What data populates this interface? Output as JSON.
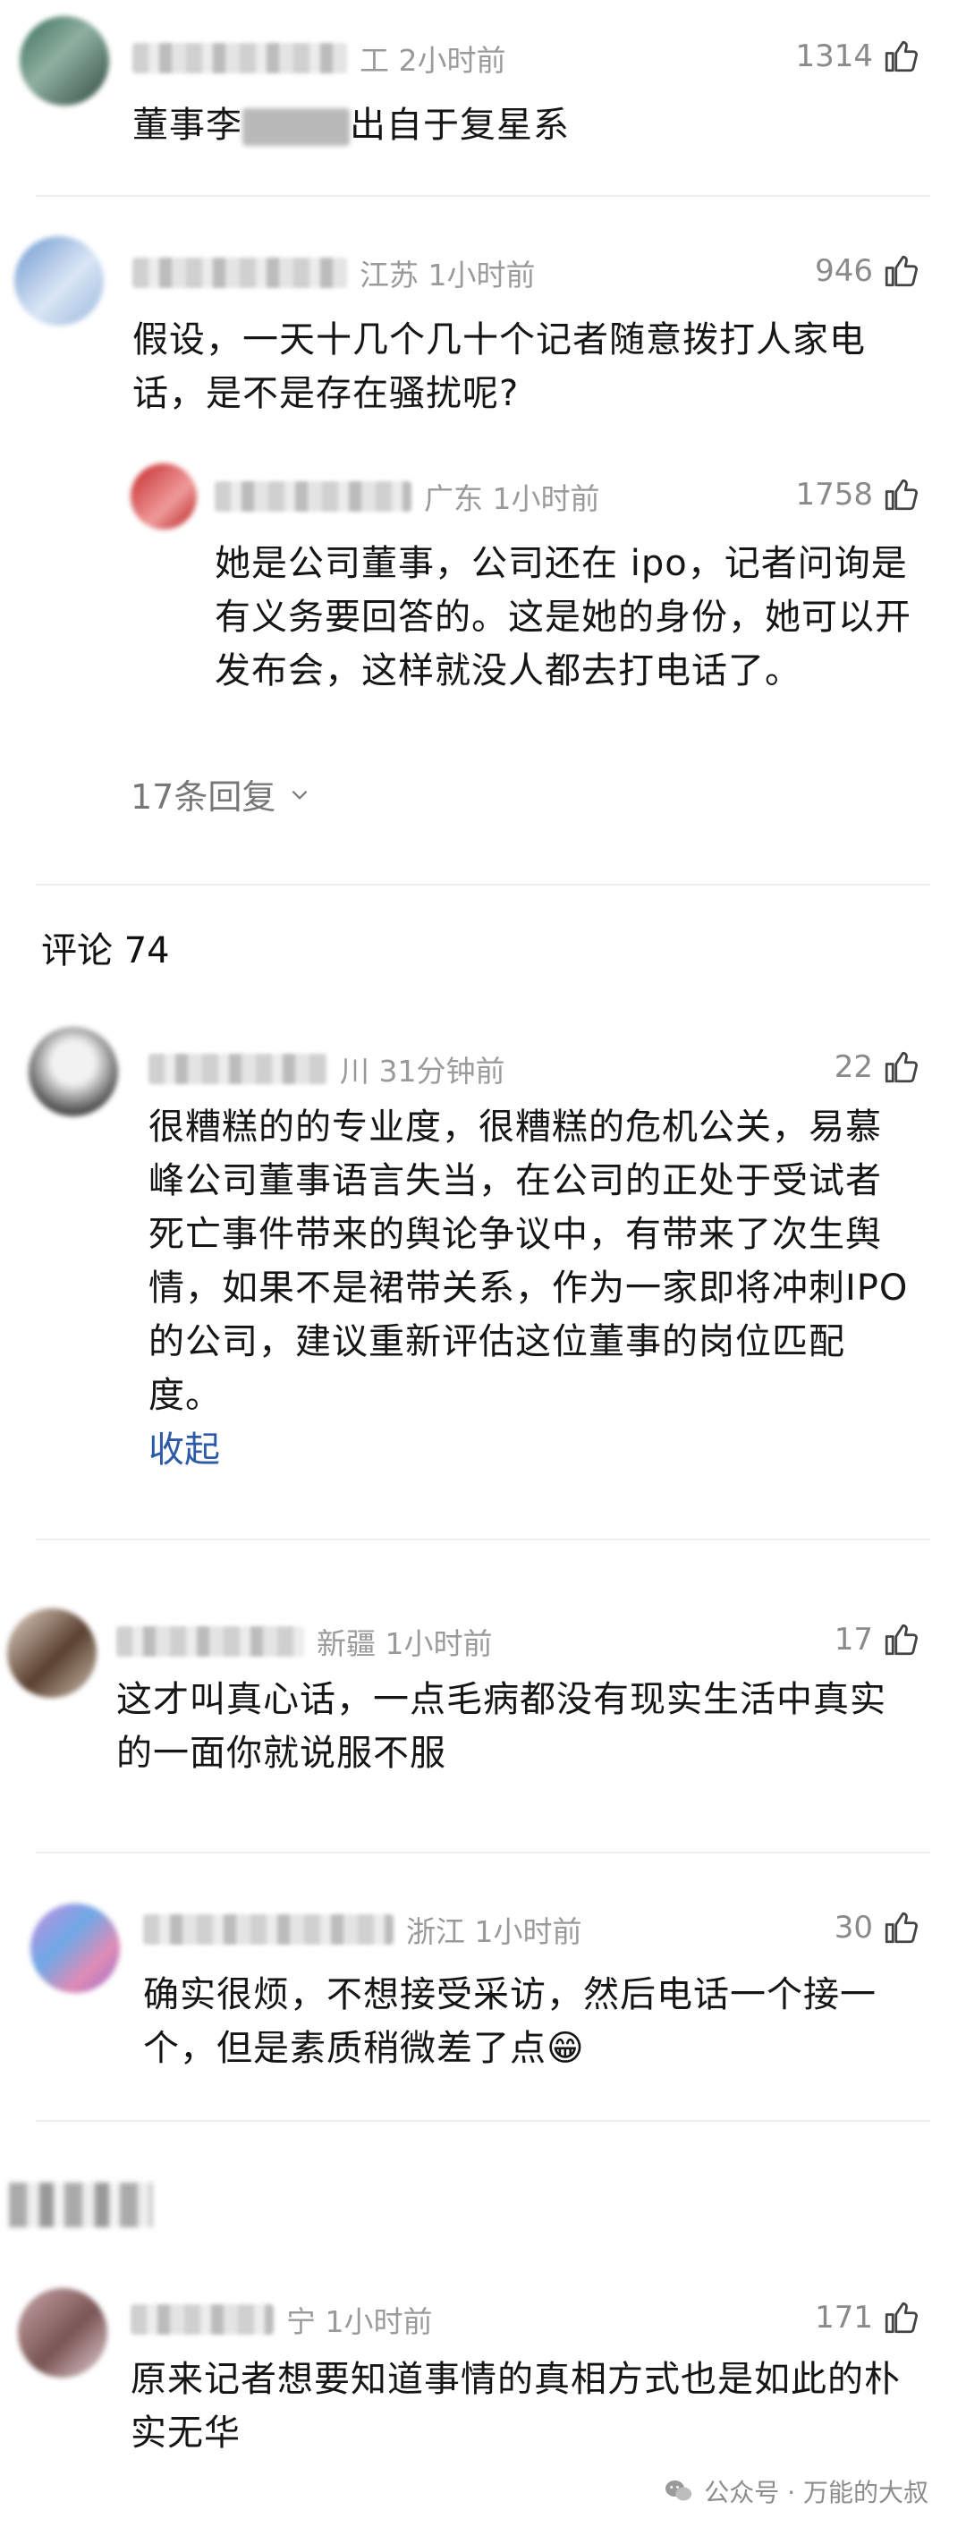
{
  "comments": [
    {
      "location_time": "工 2小时前",
      "likes": "1314",
      "text_pre": "董事李",
      "text_post": "出自于复星系"
    },
    {
      "location_time": "江苏 1小时前",
      "likes": "946",
      "text": "假设，一天十几个几十个记者随意拨打人家电话，是不是存在骚扰呢?",
      "reply": {
        "location_time": "广东 1小时前",
        "likes": "1758",
        "text": "她是公司董事，公司还在 ipo，记者问询是有义务要回答的。这是她的身份，她可以开发布会，这样就没人都去打电话了。"
      },
      "replies_label": "17条回复"
    },
    {
      "location_time": "川 31分钟前",
      "likes": "22",
      "text": "很糟糕的的专业度，很糟糕的危机公关，易慕峰公司董事语言失当，在公司的正处于受试者死亡事件带来的舆论争议中，有带来了次生舆情，如果不是裙带关系，作为一家即将冲刺IPO的公司，建议重新评估这位董事的岗位匹配度。",
      "collapse": "收起"
    },
    {
      "location_time": "新疆 1小时前",
      "likes": "17",
      "text": "这才叫真心话，一点毛病都没有现实生活中真实的一面你就说服不服"
    },
    {
      "location_time": "浙江 1小时前",
      "likes": "30",
      "text": "确实很烦，不想接受采访，然后电话一个接一个，但是素质稍微差了点",
      "emoji": "😁"
    },
    {
      "location_time": "宁 1小时前",
      "likes": "171",
      "text": "原来记者想要知道事情的真相方式也是如此的朴实无华"
    }
  ],
  "section_label": "评论 74",
  "watermark": "公众号 · 万能的大叔",
  "icons": {
    "like": "thumbs-up-icon",
    "chevron": "chevron-down-icon",
    "wechat": "wechat-icon"
  }
}
